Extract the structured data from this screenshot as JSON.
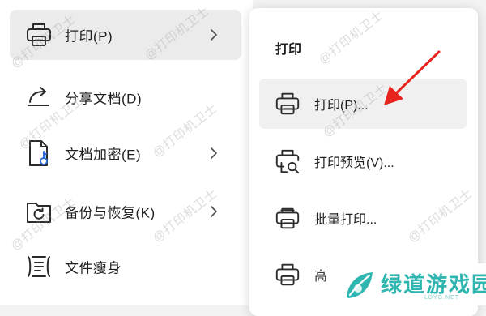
{
  "main_menu": {
    "items": [
      {
        "label": "打印(P)",
        "icon": "printer-icon",
        "has_submenu": true,
        "selected": true
      },
      {
        "label": "分享文档(D)",
        "icon": "share-icon",
        "has_submenu": false,
        "selected": false
      },
      {
        "label": "文档加密(E)",
        "icon": "lock-document-icon",
        "has_submenu": true,
        "selected": false
      },
      {
        "label": "备份与恢复(K)",
        "icon": "backup-restore-icon",
        "has_submenu": true,
        "selected": false
      },
      {
        "label": "文件瘦身",
        "icon": "file-slim-icon",
        "has_submenu": false,
        "selected": false
      }
    ]
  },
  "submenu": {
    "title": "打印",
    "items": [
      {
        "label": "打印(P)...",
        "icon": "printer-icon",
        "highlighted": true
      },
      {
        "label": "打印预览(V)...",
        "icon": "print-preview-icon",
        "highlighted": false
      },
      {
        "label": "批量打印...",
        "icon": "batch-print-icon",
        "highlighted": false
      },
      {
        "label": "高",
        "icon": "printer-icon",
        "highlighted": false
      }
    ]
  },
  "annotation": {
    "color": "#e8231d",
    "icon": "red-arrow-icon"
  },
  "watermark_text": "@打印机卫士",
  "logo": {
    "text": "绿道游戏园",
    "sub": "LDYG.NET",
    "color": "#30b6b0"
  },
  "colors": {
    "selected_bg": "#ebebeb",
    "highlight_bg": "#f0f0f0",
    "page_bg": "#f3f3f3"
  }
}
